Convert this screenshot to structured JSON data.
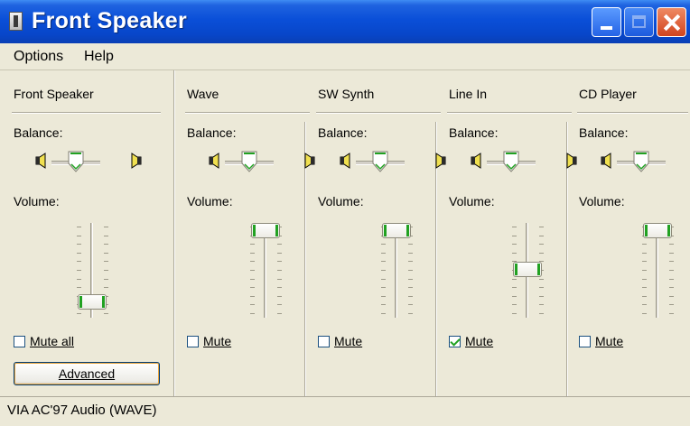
{
  "window": {
    "title": "Front Speaker"
  },
  "menu": {
    "items": [
      "Options",
      "Help"
    ]
  },
  "columns": [
    {
      "name": "Front Speaker",
      "balance_label": "Balance:",
      "volume_label": "Volume:",
      "volume_level": 0.08,
      "mute_label": "Mute all",
      "muted": false
    },
    {
      "name": "Wave",
      "balance_label": "Balance:",
      "volume_label": "Volume:",
      "volume_level": 1.0,
      "mute_label": "Mute",
      "muted": false
    },
    {
      "name": "SW Synth",
      "balance_label": "Balance:",
      "volume_label": "Volume:",
      "volume_level": 1.0,
      "mute_label": "Mute",
      "muted": false
    },
    {
      "name": "Line In",
      "balance_label": "Balance:",
      "volume_label": "Volume:",
      "volume_level": 0.5,
      "mute_label": "Mute",
      "muted": true
    },
    {
      "name": "CD Player",
      "balance_label": "Balance:",
      "volume_label": "Volume:",
      "volume_level": 1.0,
      "mute_label": "Mute",
      "muted": false
    }
  ],
  "advanced_button": "Advanced",
  "status_bar": "VIA AC'97 Audio (WAVE)",
  "icons": {
    "left_speaker": "speaker-left-icon",
    "right_speaker": "speaker-right-icon"
  },
  "colors": {
    "titlebar": "#0A4FD8",
    "accent_green": "#21A121",
    "face": "#ECE9D8"
  }
}
